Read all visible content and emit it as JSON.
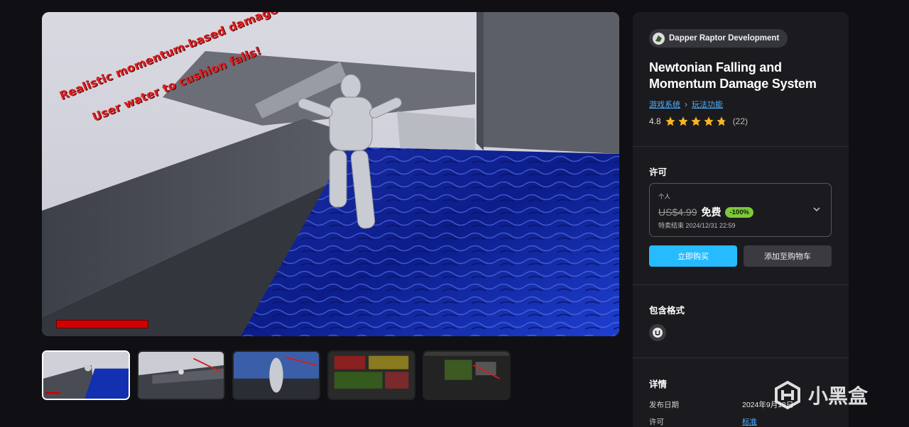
{
  "hero": {
    "overlay_line1": "Realistic momentum-based damage!",
    "overlay_line2": "User water to cushion falls!"
  },
  "thumbnails": [
    {
      "name": "thumb-1",
      "active": true
    },
    {
      "name": "thumb-2",
      "active": false
    },
    {
      "name": "thumb-3",
      "active": false
    },
    {
      "name": "thumb-4",
      "active": false
    },
    {
      "name": "thumb-5",
      "active": false
    }
  ],
  "product": {
    "seller": "Dapper Raptor Development",
    "title": "Newtonian Falling and Momentum Damage System",
    "breadcrumb": [
      "游戏系统",
      "玩法功能"
    ],
    "rating": "4.8",
    "rating_count": "(22)"
  },
  "license": {
    "section_label": "许可",
    "type": "个人",
    "old_price": "US$4.99",
    "new_price": "免费",
    "discount": "-100%",
    "sale_end": "特卖结束 2024/12/31 22:59",
    "buy_label": "立即购买",
    "cart_label": "添加至购物车"
  },
  "formats": {
    "section_label": "包含格式",
    "icon": "unreal-engine-icon"
  },
  "details": {
    "section_label": "详情",
    "rows": [
      {
        "key": "发布日期",
        "value": "2024年9月18日"
      },
      {
        "key": "许可",
        "value": "标准"
      }
    ]
  },
  "watermark": {
    "text": "小黑盒"
  },
  "colors": {
    "accent": "#26bbff",
    "discount": "#7cc93a",
    "star": "#f5b623",
    "background": "#101014",
    "panel": "#1b1b1f"
  }
}
